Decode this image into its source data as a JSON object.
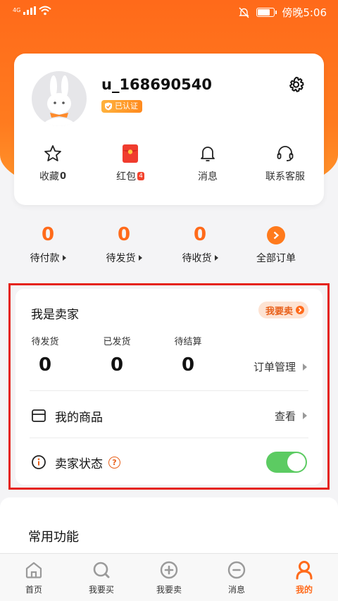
{
  "status_bar": {
    "network": "4G",
    "time": "傍晚5:06"
  },
  "profile": {
    "username": "u_168690540",
    "verified_label": "已认证"
  },
  "quick_actions": [
    {
      "label": "收藏",
      "count": "0",
      "icon": "star-icon"
    },
    {
      "label": "红包",
      "badge": "4",
      "icon": "red-packet-icon"
    },
    {
      "label": "消息",
      "icon": "bell-icon"
    },
    {
      "label": "联系客服",
      "icon": "headset-icon"
    }
  ],
  "orders": [
    {
      "count": "0",
      "label": "待付款"
    },
    {
      "count": "0",
      "label": "待发货"
    },
    {
      "count": "0",
      "label": "待收货"
    },
    {
      "label": "全部订单"
    }
  ],
  "seller": {
    "title": "我是卖家",
    "sell_button": "我要卖",
    "stats": [
      {
        "label": "待发货",
        "value": "0"
      },
      {
        "label": "已发货",
        "value": "0"
      },
      {
        "label": "待结算",
        "value": "0"
      }
    ],
    "order_management": "订单管理",
    "my_goods": {
      "label": "我的商品",
      "action": "查看"
    },
    "status": {
      "label": "卖家状态",
      "help": "?",
      "toggle_on": true
    }
  },
  "common": {
    "title": "常用功能"
  },
  "tabbar": [
    {
      "label": "首页",
      "icon": "home-icon",
      "active": false
    },
    {
      "label": "我要买",
      "icon": "buy-search-icon",
      "active": false
    },
    {
      "label": "我要卖",
      "icon": "sell-plus-icon",
      "active": false
    },
    {
      "label": "消息",
      "icon": "message-icon",
      "active": false
    },
    {
      "label": "我的",
      "icon": "profile-icon",
      "active": true
    }
  ],
  "colors": {
    "accent": "#ff6a1a",
    "toggle_on": "#5ccb62",
    "highlight_frame": "#e5231a"
  }
}
